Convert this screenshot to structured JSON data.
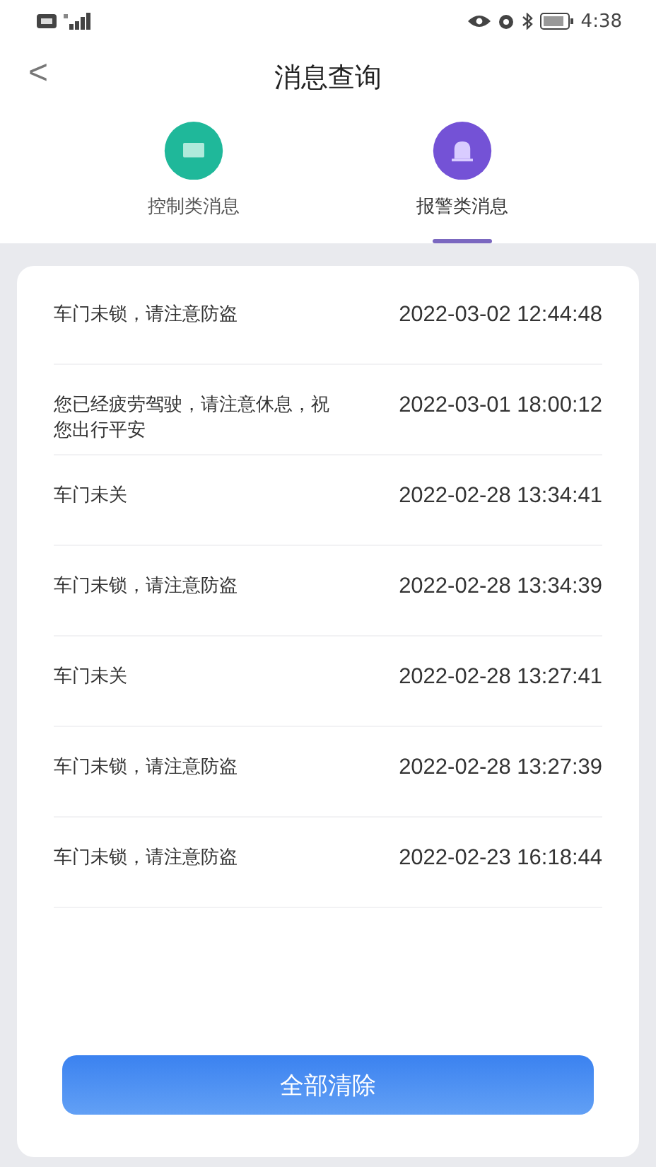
{
  "status_bar": {
    "time": "4:38"
  },
  "header": {
    "back": "<",
    "title": "消息查询"
  },
  "tabs": [
    {
      "label": "控制类消息",
      "selected": false,
      "color": "#1fb89a"
    },
    {
      "label": "报警类消息",
      "selected": true,
      "color": "#7452d6"
    }
  ],
  "messages": [
    {
      "text": "车门未锁，请注意防盗",
      "time": "2022-03-02 12:44:48"
    },
    {
      "text": "您已经疲劳驾驶，请注意休息，祝您出行平安",
      "time": "2022-03-01 18:00:12"
    },
    {
      "text": "车门未关",
      "time": "2022-02-28 13:34:41"
    },
    {
      "text": "车门未锁，请注意防盗",
      "time": "2022-02-28 13:34:39"
    },
    {
      "text": "车门未关",
      "time": "2022-02-28 13:27:41"
    },
    {
      "text": "车门未锁，请注意防盗",
      "time": "2022-02-28 13:27:39"
    },
    {
      "text": "车门未锁，请注意防盗",
      "time": "2022-02-23 16:18:44"
    }
  ],
  "clear_button": "全部清除"
}
